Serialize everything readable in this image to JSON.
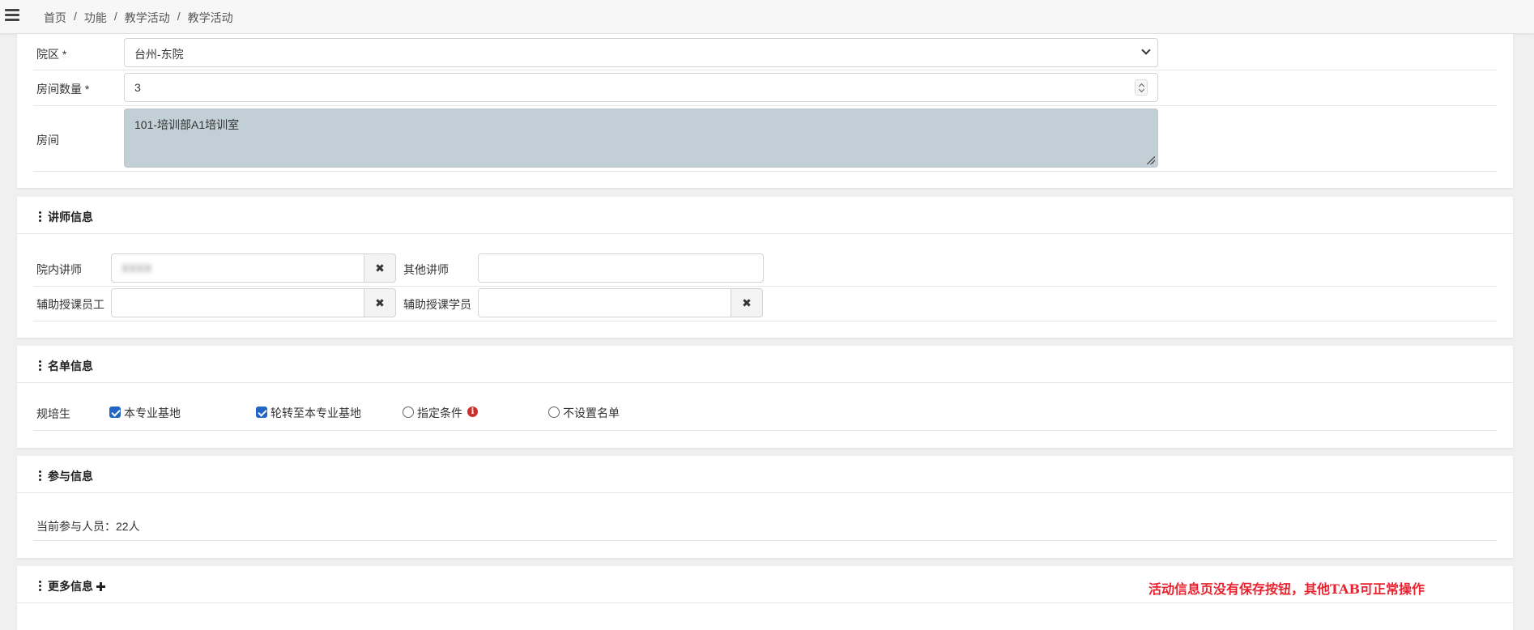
{
  "breadcrumb": {
    "items": [
      "首页",
      "功能",
      "教学活动",
      "教学活动"
    ],
    "separator": "/"
  },
  "location": {
    "campus_label": "院区 *",
    "campus_value": "台州-东院",
    "room_count_label": "房间数量 *",
    "room_count_value": "3",
    "room_label": "房间",
    "room_value": "101-培训部A1培训室"
  },
  "lecturer": {
    "title": "讲师信息",
    "internal_label": "院内讲师",
    "internal_value": "XXXX",
    "other_label": "其他讲师",
    "other_value": "",
    "assist_staff_label": "辅助授课员工",
    "assist_student_label": "辅助授课学员",
    "clear_icon": "✖"
  },
  "roster": {
    "title": "名单信息",
    "trainee_label": "规培生",
    "options": [
      {
        "label": "本专业基地",
        "checked": true
      },
      {
        "label": "轮转至本专业基地",
        "checked": true
      },
      {
        "label": "指定条件",
        "checked": false
      },
      {
        "label": "不设置名单",
        "checked": false
      }
    ],
    "info_icon": "i"
  },
  "participation": {
    "title": "参与信息",
    "current_text": "当前参与人员：22人"
  },
  "more": {
    "title": "更多信息"
  },
  "annotation": {
    "text": "活动信息页没有保存按钮，其他TAB可正常操作",
    "color": "#e8232f"
  },
  "colors": {
    "checkbox": "#2166c6",
    "textarea_bg": "#c2cfd7",
    "info_icon": "#c9302c"
  }
}
